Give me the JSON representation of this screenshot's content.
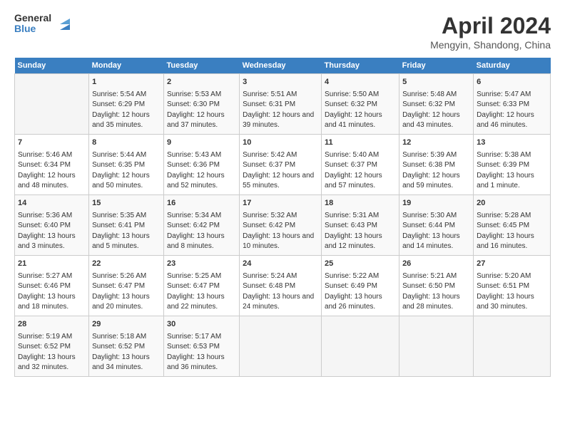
{
  "header": {
    "logo_line1": "General",
    "logo_line2": "Blue",
    "title": "April 2024",
    "subtitle": "Mengyin, Shandong, China"
  },
  "days_of_week": [
    "Sunday",
    "Monday",
    "Tuesday",
    "Wednesday",
    "Thursday",
    "Friday",
    "Saturday"
  ],
  "weeks": [
    [
      {
        "day": "",
        "empty": true
      },
      {
        "day": "1",
        "sunrise": "Sunrise: 5:54 AM",
        "sunset": "Sunset: 6:29 PM",
        "daylight": "Daylight: 12 hours and 35 minutes."
      },
      {
        "day": "2",
        "sunrise": "Sunrise: 5:53 AM",
        "sunset": "Sunset: 6:30 PM",
        "daylight": "Daylight: 12 hours and 37 minutes."
      },
      {
        "day": "3",
        "sunrise": "Sunrise: 5:51 AM",
        "sunset": "Sunset: 6:31 PM",
        "daylight": "Daylight: 12 hours and 39 minutes."
      },
      {
        "day": "4",
        "sunrise": "Sunrise: 5:50 AM",
        "sunset": "Sunset: 6:32 PM",
        "daylight": "Daylight: 12 hours and 41 minutes."
      },
      {
        "day": "5",
        "sunrise": "Sunrise: 5:48 AM",
        "sunset": "Sunset: 6:32 PM",
        "daylight": "Daylight: 12 hours and 43 minutes."
      },
      {
        "day": "6",
        "sunrise": "Sunrise: 5:47 AM",
        "sunset": "Sunset: 6:33 PM",
        "daylight": "Daylight: 12 hours and 46 minutes."
      }
    ],
    [
      {
        "day": "7",
        "sunrise": "Sunrise: 5:46 AM",
        "sunset": "Sunset: 6:34 PM",
        "daylight": "Daylight: 12 hours and 48 minutes."
      },
      {
        "day": "8",
        "sunrise": "Sunrise: 5:44 AM",
        "sunset": "Sunset: 6:35 PM",
        "daylight": "Daylight: 12 hours and 50 minutes."
      },
      {
        "day": "9",
        "sunrise": "Sunrise: 5:43 AM",
        "sunset": "Sunset: 6:36 PM",
        "daylight": "Daylight: 12 hours and 52 minutes."
      },
      {
        "day": "10",
        "sunrise": "Sunrise: 5:42 AM",
        "sunset": "Sunset: 6:37 PM",
        "daylight": "Daylight: 12 hours and 55 minutes."
      },
      {
        "day": "11",
        "sunrise": "Sunrise: 5:40 AM",
        "sunset": "Sunset: 6:37 PM",
        "daylight": "Daylight: 12 hours and 57 minutes."
      },
      {
        "day": "12",
        "sunrise": "Sunrise: 5:39 AM",
        "sunset": "Sunset: 6:38 PM",
        "daylight": "Daylight: 12 hours and 59 minutes."
      },
      {
        "day": "13",
        "sunrise": "Sunrise: 5:38 AM",
        "sunset": "Sunset: 6:39 PM",
        "daylight": "Daylight: 13 hours and 1 minute."
      }
    ],
    [
      {
        "day": "14",
        "sunrise": "Sunrise: 5:36 AM",
        "sunset": "Sunset: 6:40 PM",
        "daylight": "Daylight: 13 hours and 3 minutes."
      },
      {
        "day": "15",
        "sunrise": "Sunrise: 5:35 AM",
        "sunset": "Sunset: 6:41 PM",
        "daylight": "Daylight: 13 hours and 5 minutes."
      },
      {
        "day": "16",
        "sunrise": "Sunrise: 5:34 AM",
        "sunset": "Sunset: 6:42 PM",
        "daylight": "Daylight: 13 hours and 8 minutes."
      },
      {
        "day": "17",
        "sunrise": "Sunrise: 5:32 AM",
        "sunset": "Sunset: 6:42 PM",
        "daylight": "Daylight: 13 hours and 10 minutes."
      },
      {
        "day": "18",
        "sunrise": "Sunrise: 5:31 AM",
        "sunset": "Sunset: 6:43 PM",
        "daylight": "Daylight: 13 hours and 12 minutes."
      },
      {
        "day": "19",
        "sunrise": "Sunrise: 5:30 AM",
        "sunset": "Sunset: 6:44 PM",
        "daylight": "Daylight: 13 hours and 14 minutes."
      },
      {
        "day": "20",
        "sunrise": "Sunrise: 5:28 AM",
        "sunset": "Sunset: 6:45 PM",
        "daylight": "Daylight: 13 hours and 16 minutes."
      }
    ],
    [
      {
        "day": "21",
        "sunrise": "Sunrise: 5:27 AM",
        "sunset": "Sunset: 6:46 PM",
        "daylight": "Daylight: 13 hours and 18 minutes."
      },
      {
        "day": "22",
        "sunrise": "Sunrise: 5:26 AM",
        "sunset": "Sunset: 6:47 PM",
        "daylight": "Daylight: 13 hours and 20 minutes."
      },
      {
        "day": "23",
        "sunrise": "Sunrise: 5:25 AM",
        "sunset": "Sunset: 6:47 PM",
        "daylight": "Daylight: 13 hours and 22 minutes."
      },
      {
        "day": "24",
        "sunrise": "Sunrise: 5:24 AM",
        "sunset": "Sunset: 6:48 PM",
        "daylight": "Daylight: 13 hours and 24 minutes."
      },
      {
        "day": "25",
        "sunrise": "Sunrise: 5:22 AM",
        "sunset": "Sunset: 6:49 PM",
        "daylight": "Daylight: 13 hours and 26 minutes."
      },
      {
        "day": "26",
        "sunrise": "Sunrise: 5:21 AM",
        "sunset": "Sunset: 6:50 PM",
        "daylight": "Daylight: 13 hours and 28 minutes."
      },
      {
        "day": "27",
        "sunrise": "Sunrise: 5:20 AM",
        "sunset": "Sunset: 6:51 PM",
        "daylight": "Daylight: 13 hours and 30 minutes."
      }
    ],
    [
      {
        "day": "28",
        "sunrise": "Sunrise: 5:19 AM",
        "sunset": "Sunset: 6:52 PM",
        "daylight": "Daylight: 13 hours and 32 minutes."
      },
      {
        "day": "29",
        "sunrise": "Sunrise: 5:18 AM",
        "sunset": "Sunset: 6:52 PM",
        "daylight": "Daylight: 13 hours and 34 minutes."
      },
      {
        "day": "30",
        "sunrise": "Sunrise: 5:17 AM",
        "sunset": "Sunset: 6:53 PM",
        "daylight": "Daylight: 13 hours and 36 minutes."
      },
      {
        "day": "",
        "empty": true
      },
      {
        "day": "",
        "empty": true
      },
      {
        "day": "",
        "empty": true
      },
      {
        "day": "",
        "empty": true
      }
    ]
  ]
}
